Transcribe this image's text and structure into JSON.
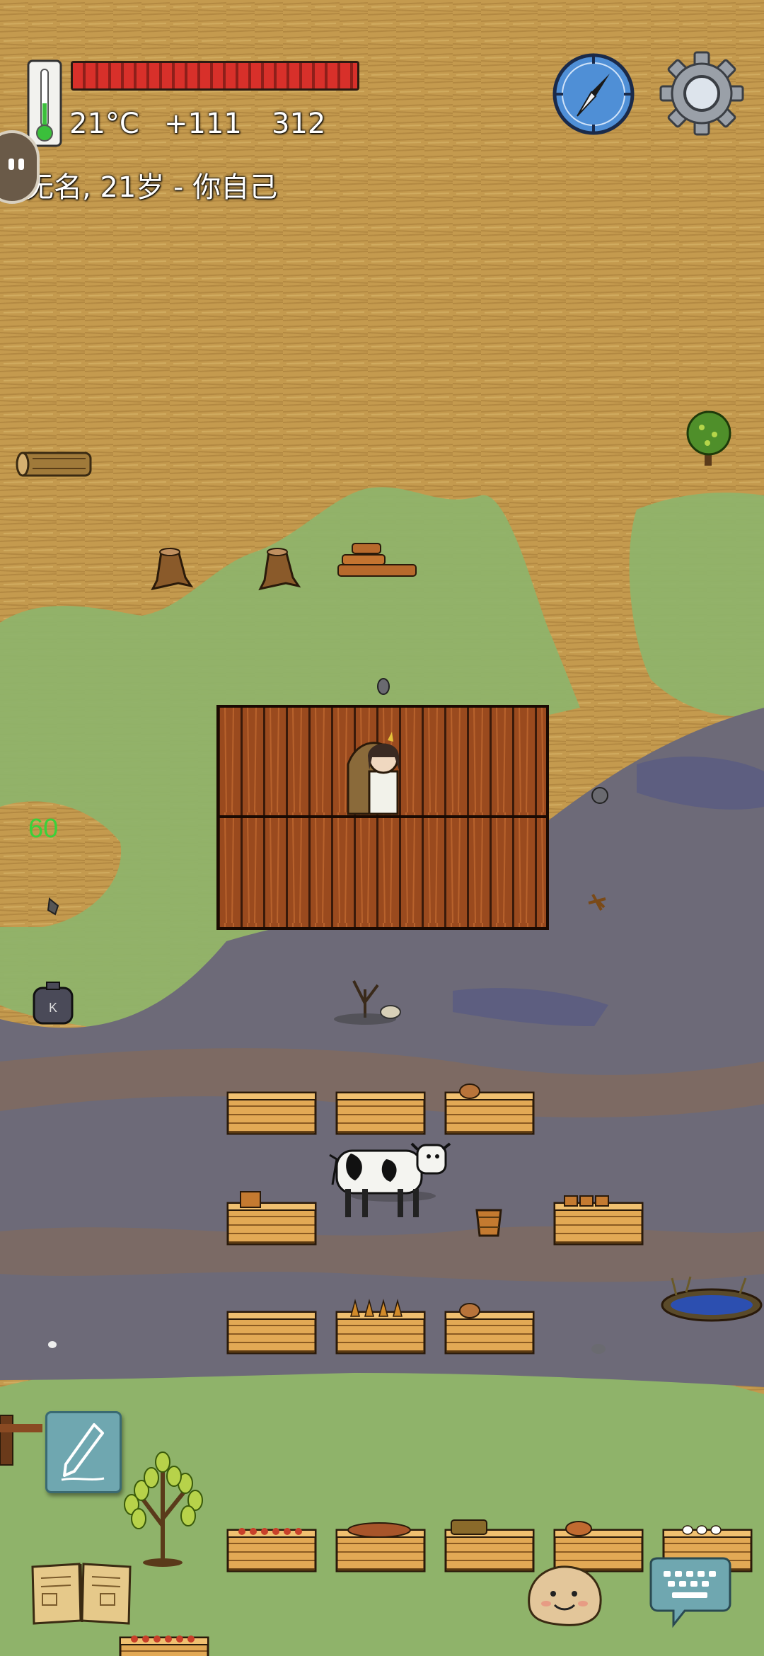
{
  "status": {
    "temperature": "21°C",
    "yum_bonus": "+111",
    "score": "312",
    "player_line": "无名, 21岁 - 你自己",
    "food_level": 1.0
  },
  "debug": {
    "fps": "60"
  },
  "icons": {
    "thermometer": "thermometer-icon",
    "compass": "compass-icon",
    "settings": "gear-icon",
    "edit": "pencil-icon",
    "recipe_book": "book-icon",
    "emote": "smiley-face-icon",
    "chat": "keyboard-icon"
  },
  "colors": {
    "health_bar": "#d8302a",
    "fps_text": "#3ad13a",
    "grassland": "#c49a4e",
    "meadow": "#8fb36a",
    "swamp": "#6d6a78"
  }
}
